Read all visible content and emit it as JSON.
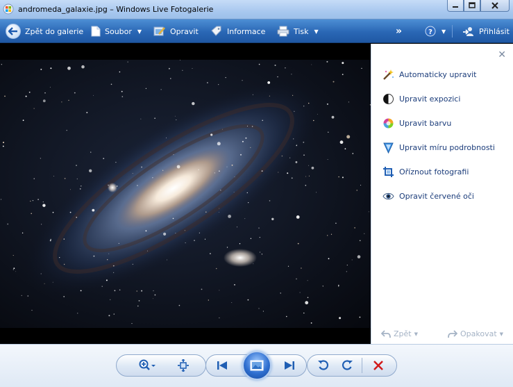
{
  "window": {
    "title": "andromeda_galaxie.jpg – Windows Live Fotogalerie"
  },
  "toolbar": {
    "back_label": "Zpět do galerie",
    "file_label": "Soubor",
    "fix_label": "Opravit",
    "info_label": "Informace",
    "print_label": "Tisk",
    "more_symbol": "»",
    "signin_label": "Přihlásit"
  },
  "panel": {
    "items": [
      {
        "label": "Automaticky upravit",
        "icon": "magic-wand-icon"
      },
      {
        "label": "Upravit expozici",
        "icon": "exposure-icon"
      },
      {
        "label": "Upravit barvu",
        "icon": "color-wheel-icon"
      },
      {
        "label": "Upravit míru podrobnosti",
        "icon": "detail-triangle-icon"
      },
      {
        "label": "Oříznout fotografii",
        "icon": "crop-icon"
      },
      {
        "label": "Opravit červené oči",
        "icon": "red-eye-icon"
      }
    ],
    "undo_label": "Zpět",
    "redo_label": "Opakovat"
  },
  "colors": {
    "toolbar_blue": "#2a67b5",
    "link_blue": "#1b3c7a",
    "delete_red": "#d11a1a"
  }
}
